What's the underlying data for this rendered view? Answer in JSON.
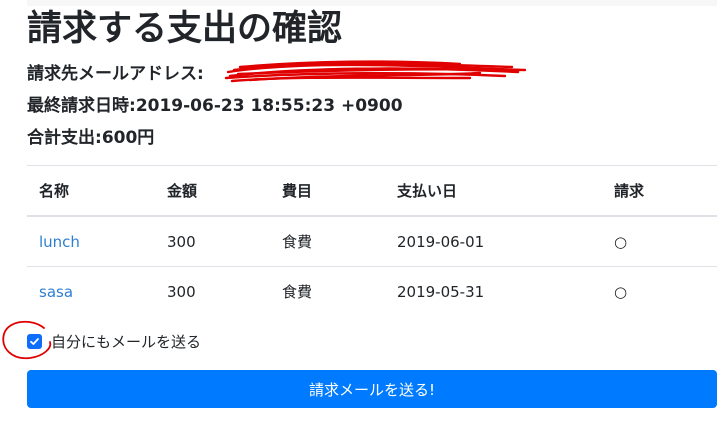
{
  "page": {
    "title": "請求する支出の確認"
  },
  "info": {
    "email_label": "請求先メールアドレス:",
    "date_label": "最終請求日時:",
    "date_value": "2019-06-23 18:55:23 +0900",
    "total_label": "合計支出:",
    "total_value": "600円"
  },
  "table": {
    "headers": [
      "名称",
      "金額",
      "費目",
      "支払い日",
      "請求"
    ],
    "rows": [
      {
        "name": "lunch",
        "amount": "300",
        "category": "食費",
        "date": "2019-06-01",
        "billed": "○"
      },
      {
        "name": "sasa",
        "amount": "300",
        "category": "食費",
        "date": "2019-05-31",
        "billed": "○"
      }
    ]
  },
  "send_self": {
    "label": "自分にもメールを送る",
    "checked": true
  },
  "submit": {
    "label": "請求メールを送る!"
  },
  "colors": {
    "primary": "#007bff",
    "link": "#2f7fd1",
    "annotation": "#e00000"
  }
}
